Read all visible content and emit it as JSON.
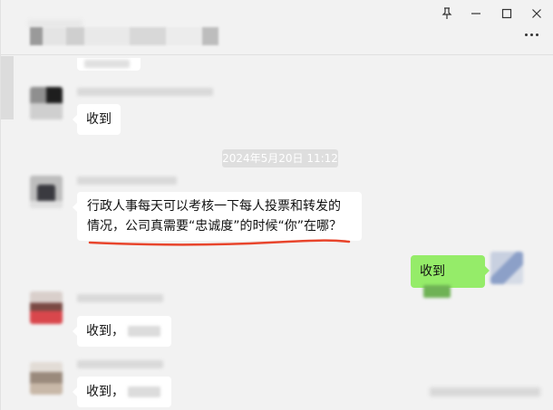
{
  "window": {
    "controls": {
      "pin_icon": "pin-icon",
      "min_label": "—",
      "max_label": "☐",
      "close_label": "✕"
    },
    "more_icon": "more-dots-icon"
  },
  "messages": [
    {
      "sender": "other",
      "text": "收到"
    },
    {
      "sender": "other",
      "text": "行政人事每天可以考核一下每人投票和转发的情况，公司真需要“忠诚度”的时候“你”在哪？"
    },
    {
      "sender": "me",
      "text": "收到"
    },
    {
      "sender": "other",
      "text": "收到，"
    },
    {
      "sender": "other",
      "text": "收到，"
    }
  ],
  "timestamp": "2024年5月20日 11:12",
  "colors": {
    "my_bubble": "#95ec69",
    "other_bubble": "#ffffff",
    "underline": "#e8452c",
    "background": "#f2f2f2"
  }
}
